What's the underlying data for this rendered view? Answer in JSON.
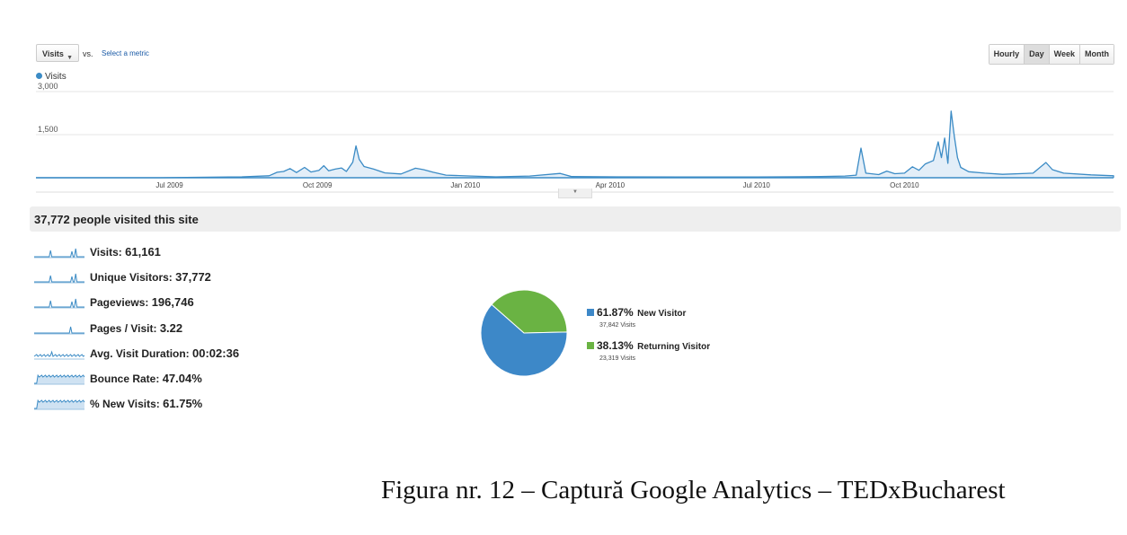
{
  "toolbar": {
    "metric_label": "Visits",
    "vs_label": "vs.",
    "select_metric": "Select a metric",
    "granularity": [
      "Hourly",
      "Day",
      "Week",
      "Month"
    ],
    "active_granularity": "Day"
  },
  "colors": {
    "line": "#3b8bc5",
    "new_visitor": "#3d88c8",
    "returning_visitor": "#6ab343",
    "summary_bg": "#eeeeee"
  },
  "chart_data": {
    "type": "area",
    "legend": [
      "Visits"
    ],
    "y_ticks": [
      "3,000",
      "1,500"
    ],
    "ylim": [
      0,
      3000
    ],
    "x_ticks": [
      "Jul 2009",
      "Oct 2009",
      "Jan 2010",
      "Apr 2010",
      "Jul 2010",
      "Oct 2010"
    ],
    "points": [
      [
        "2009-04-09",
        0
      ],
      [
        "2009-06-25",
        0
      ],
      [
        "2009-07-05",
        6
      ],
      [
        "2009-07-25",
        20
      ],
      [
        "2009-08-15",
        30
      ],
      [
        "2009-09-01",
        70
      ],
      [
        "2009-09-06",
        190
      ],
      [
        "2009-09-10",
        220
      ],
      [
        "2009-09-14",
        320
      ],
      [
        "2009-09-18",
        180
      ],
      [
        "2009-09-23",
        360
      ],
      [
        "2009-09-27",
        200
      ],
      [
        "2009-10-02",
        260
      ],
      [
        "2009-10-05",
        420
      ],
      [
        "2009-10-08",
        240
      ],
      [
        "2009-10-12",
        300
      ],
      [
        "2009-10-16",
        340
      ],
      [
        "2009-10-19",
        220
      ],
      [
        "2009-10-23",
        540
      ],
      [
        "2009-10-25",
        1110
      ],
      [
        "2009-10-27",
        640
      ],
      [
        "2009-10-30",
        390
      ],
      [
        "2009-11-05",
        300
      ],
      [
        "2009-11-12",
        170
      ],
      [
        "2009-11-22",
        130
      ],
      [
        "2009-12-01",
        330
      ],
      [
        "2009-12-06",
        280
      ],
      [
        "2009-12-12",
        190
      ],
      [
        "2009-12-20",
        90
      ],
      [
        "2010-01-05",
        60
      ],
      [
        "2010-01-20",
        30
      ],
      [
        "2010-02-10",
        60
      ],
      [
        "2010-03-01",
        150
      ],
      [
        "2010-03-08",
        40
      ],
      [
        "2010-04-05",
        30
      ],
      [
        "2010-05-15",
        25
      ],
      [
        "2010-07-01",
        25
      ],
      [
        "2010-08-10",
        40
      ],
      [
        "2010-08-25",
        60
      ],
      [
        "2010-09-01",
        90
      ],
      [
        "2010-09-04",
        1030
      ],
      [
        "2010-09-07",
        160
      ],
      [
        "2010-09-15",
        110
      ],
      [
        "2010-09-20",
        230
      ],
      [
        "2010-09-25",
        140
      ],
      [
        "2010-10-01",
        160
      ],
      [
        "2010-10-06",
        380
      ],
      [
        "2010-10-10",
        260
      ],
      [
        "2010-10-14",
        480
      ],
      [
        "2010-10-19",
        600
      ],
      [
        "2010-10-22",
        1250
      ],
      [
        "2010-10-24",
        700
      ],
      [
        "2010-10-26",
        1380
      ],
      [
        "2010-10-28",
        500
      ],
      [
        "2010-10-30",
        2320
      ],
      [
        "2010-11-01",
        1460
      ],
      [
        "2010-11-03",
        700
      ],
      [
        "2010-11-05",
        360
      ],
      [
        "2010-11-10",
        210
      ],
      [
        "2010-11-20",
        160
      ],
      [
        "2010-12-01",
        120
      ],
      [
        "2010-12-20",
        160
      ],
      [
        "2010-12-28",
        530
      ],
      [
        "2011-01-01",
        280
      ],
      [
        "2011-01-08",
        160
      ],
      [
        "2011-01-25",
        100
      ],
      [
        "2011-02-08",
        70
      ]
    ]
  },
  "summary": {
    "title": "37,772 people visited this site",
    "metrics": [
      {
        "label": "Visits: ",
        "value": "61,161",
        "spark": "spike"
      },
      {
        "label": "Unique Visitors: ",
        "value": "37,772",
        "spark": "spike"
      },
      {
        "label": "Pageviews: ",
        "value": "196,746",
        "spark": "spike"
      },
      {
        "label": "Pages / Visit: ",
        "value": "3.22",
        "spark": "flat"
      },
      {
        "label": "Avg. Visit Duration: ",
        "value": "00:02:36",
        "spark": "noisy"
      },
      {
        "label": "Bounce Rate: ",
        "value": "47.04%",
        "spark": "plateau"
      },
      {
        "label": "% New Visits: ",
        "value": "61.75%",
        "spark": "plateau"
      }
    ]
  },
  "pie": {
    "slices": [
      {
        "name": "New Visitor",
        "percent": "61.87%",
        "fraction": 0.6187,
        "visits": "37,842 Visits",
        "color": "#3d88c8"
      },
      {
        "name": "Returning Visitor",
        "percent": "38.13%",
        "fraction": 0.3813,
        "visits": "23,319 Visits",
        "color": "#6ab343"
      }
    ]
  },
  "caption": "Figura nr. 12 – Captură Google Analytics – TEDxBucharest"
}
